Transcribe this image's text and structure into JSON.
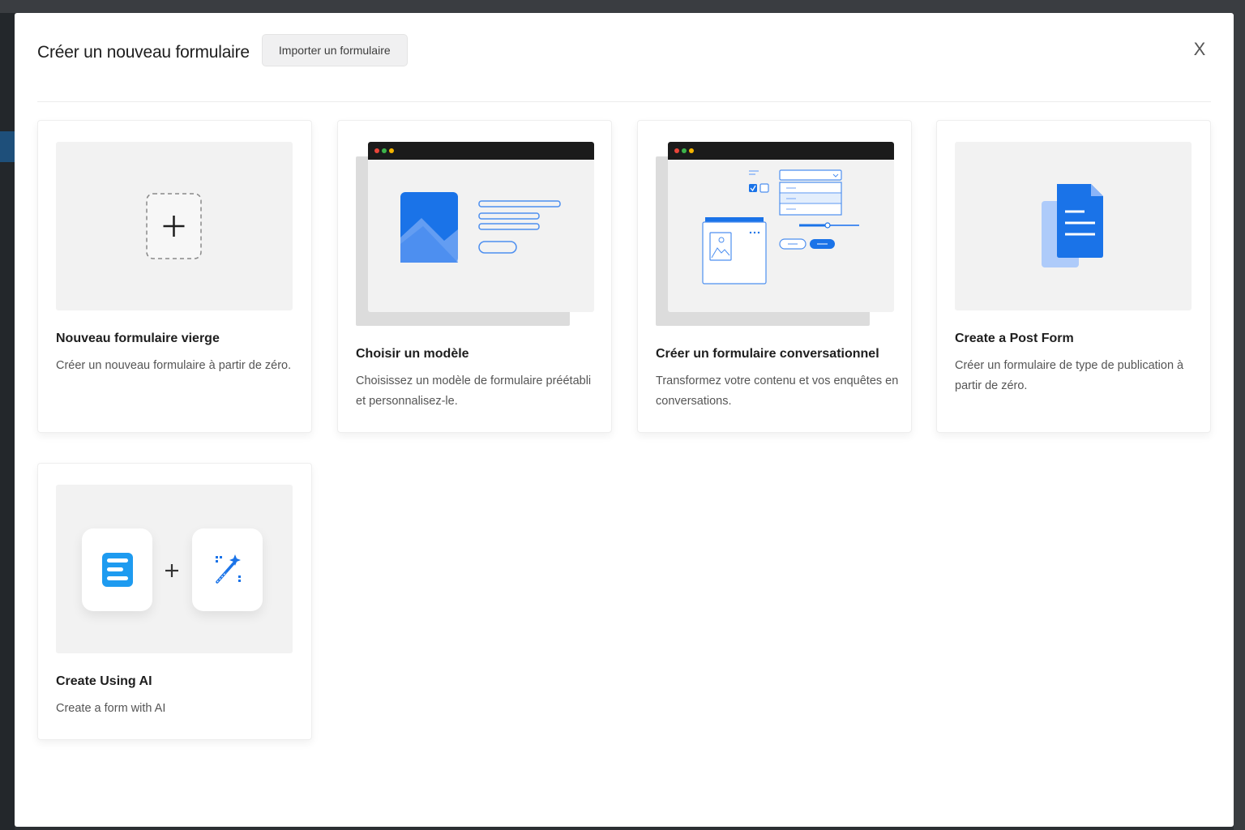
{
  "modal": {
    "title": "Créer un nouveau formulaire",
    "import_label": "Importer un formulaire",
    "close_label": "X"
  },
  "cards": [
    {
      "title": "Nouveau formulaire vierge",
      "description": "Créer un nouveau formulaire à partir de zéro."
    },
    {
      "title": "Choisir un modèle",
      "description": "Choisissez un modèle de formulaire préétabli et personnalisez-le."
    },
    {
      "title": "Créer un formulaire conversationnel",
      "description": "Transformez votre contenu et vos enquêtes en conversations."
    },
    {
      "title": "Create a Post Form",
      "description": "Créer un formulaire de type de publication à partir de zéro."
    },
    {
      "title": "Create Using AI",
      "description": "Create a form with AI"
    }
  ],
  "icons": {
    "blank": "plus-icon",
    "template": "image-template-icon",
    "conversational": "conversational-form-icon",
    "post": "document-icon",
    "ai_logo": "fluent-forms-logo",
    "ai_plus": "plus-icon",
    "ai_wand": "magic-wand-icon"
  },
  "colors": {
    "accent": "#1a73e8",
    "light_accent": "#aecbfa",
    "illustration_bg": "#f2f2f2"
  }
}
